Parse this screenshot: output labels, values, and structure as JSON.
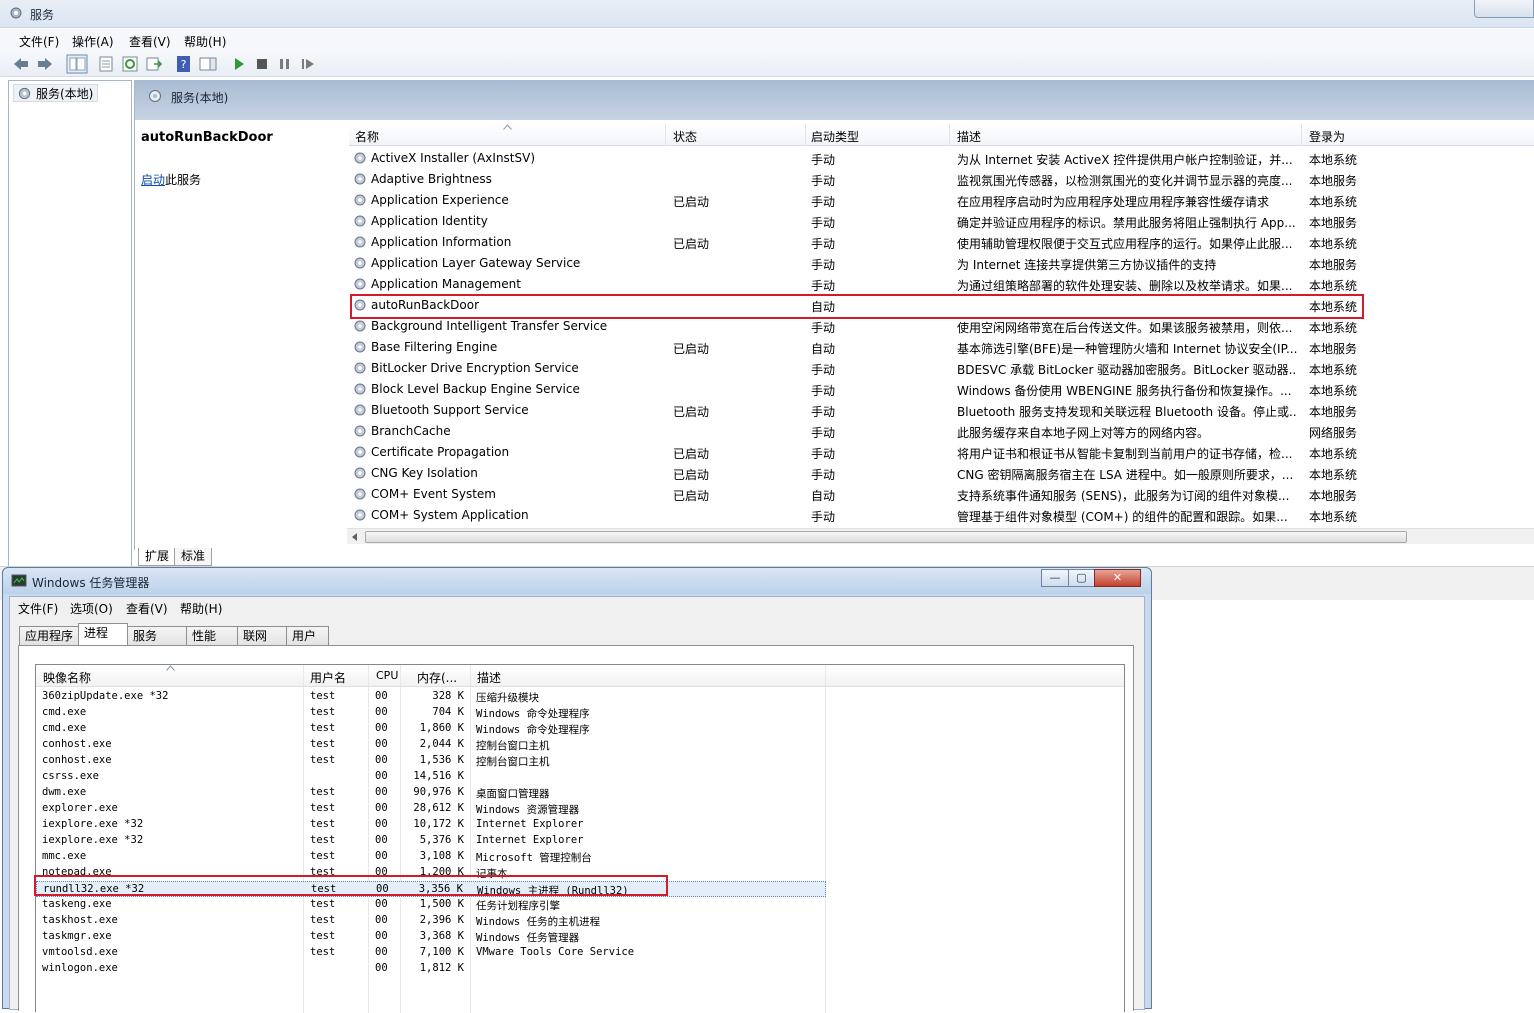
{
  "services": {
    "title": "服务",
    "menu": [
      "文件(F)",
      "操作(A)",
      "查看(V)",
      "帮助(H)"
    ],
    "tree_node": "服务(本地)",
    "header": "服务(本地)",
    "selected_name": "autoRunBackDoor",
    "start_link": "启动",
    "start_link_suffix": "此服务",
    "columns": {
      "name": "名称",
      "status": "状态",
      "startup": "启动类型",
      "desc": "描述",
      "logon": "登录为"
    },
    "rows": [
      {
        "name": "ActiveX Installer (AxInstSV)",
        "status": "",
        "startup": "手动",
        "desc": "为从 Internet 安装 ActiveX 控件提供用户帐户控制验证，并...",
        "logon": "本地系统"
      },
      {
        "name": "Adaptive Brightness",
        "status": "",
        "startup": "手动",
        "desc": "监视氛围光传感器，以检测氛围光的变化并调节显示器的亮度...",
        "logon": "本地服务"
      },
      {
        "name": "Application Experience",
        "status": "已启动",
        "startup": "手动",
        "desc": "在应用程序启动时为应用程序处理应用程序兼容性缓存请求",
        "logon": "本地系统"
      },
      {
        "name": "Application Identity",
        "status": "",
        "startup": "手动",
        "desc": "确定并验证应用程序的标识。禁用此服务将阻止强制执行 App...",
        "logon": "本地服务"
      },
      {
        "name": "Application Information",
        "status": "已启动",
        "startup": "手动",
        "desc": "使用辅助管理权限便于交互式应用程序的运行。如果停止此服...",
        "logon": "本地系统"
      },
      {
        "name": "Application Layer Gateway Service",
        "status": "",
        "startup": "手动",
        "desc": "为 Internet 连接共享提供第三方协议插件的支持",
        "logon": "本地服务"
      },
      {
        "name": "Application Management",
        "status": "",
        "startup": "手动",
        "desc": "为通过组策略部署的软件处理安装、删除以及枚举请求。如果...",
        "logon": "本地系统"
      },
      {
        "name": "autoRunBackDoor",
        "status": "",
        "startup": "自动",
        "desc": "",
        "logon": "本地系统"
      },
      {
        "name": "Background Intelligent Transfer Service",
        "status": "",
        "startup": "手动",
        "desc": "使用空闲网络带宽在后台传送文件。如果该服务被禁用，则依...",
        "logon": "本地系统"
      },
      {
        "name": "Base Filtering Engine",
        "status": "已启动",
        "startup": "自动",
        "desc": "基本筛选引擎(BFE)是一种管理防火墙和 Internet 协议安全(IP...",
        "logon": "本地服务"
      },
      {
        "name": "BitLocker Drive Encryption Service",
        "status": "",
        "startup": "手动",
        "desc": "BDESVC 承载 BitLocker 驱动器加密服务。BitLocker 驱动器...",
        "logon": "本地系统"
      },
      {
        "name": "Block Level Backup Engine Service",
        "status": "",
        "startup": "手动",
        "desc": "Windows 备份使用 WBENGINE 服务执行备份和恢复操作。...",
        "logon": "本地系统"
      },
      {
        "name": "Bluetooth Support Service",
        "status": "已启动",
        "startup": "手动",
        "desc": "Bluetooth 服务支持发现和关联远程 Bluetooth 设备。停止或...",
        "logon": "本地服务"
      },
      {
        "name": "BranchCache",
        "status": "",
        "startup": "手动",
        "desc": "此服务缓存来自本地子网上对等方的网络内容。",
        "logon": "网络服务"
      },
      {
        "name": "Certificate Propagation",
        "status": "已启动",
        "startup": "手动",
        "desc": "将用户证书和根证书从智能卡复制到当前用户的证书存储，检...",
        "logon": "本地系统"
      },
      {
        "name": "CNG Key Isolation",
        "status": "已启动",
        "startup": "手动",
        "desc": "CNG 密钥隔离服务宿主在 LSA 进程中。如一般原则所要求，...",
        "logon": "本地系统"
      },
      {
        "name": "COM+ Event System",
        "status": "已启动",
        "startup": "自动",
        "desc": "支持系统事件通知服务 (SENS)，此服务为订阅的组件对象模...",
        "logon": "本地服务"
      },
      {
        "name": "COM+ System Application",
        "status": "",
        "startup": "手动",
        "desc": "管理基于组件对象模型 (COM+) 的组件的配置和跟踪。如果...",
        "logon": "本地系统"
      }
    ],
    "tabs": [
      "扩展",
      "标准"
    ]
  },
  "taskmgr": {
    "title": "Windows 任务管理器",
    "menu": [
      "文件(F)",
      "选项(O)",
      "查看(V)",
      "帮助(H)"
    ],
    "tabs": [
      "应用程序",
      "进程",
      "服务",
      "性能",
      "联网",
      "用户"
    ],
    "active_tab": "进程",
    "columns": {
      "image": "映像名称",
      "user": "用户名",
      "cpu": "CPU",
      "mem": "内存(...",
      "desc": "描述"
    },
    "rows": [
      {
        "image": "360zipUpdate.exe *32",
        "user": "test",
        "cpu": "00",
        "mem": "328 K",
        "desc": "压缩升级模块"
      },
      {
        "image": "cmd.exe",
        "user": "test",
        "cpu": "00",
        "mem": "704 K",
        "desc": "Windows 命令处理程序"
      },
      {
        "image": "cmd.exe",
        "user": "test",
        "cpu": "00",
        "mem": "1,860 K",
        "desc": "Windows 命令处理程序"
      },
      {
        "image": "conhost.exe",
        "user": "test",
        "cpu": "00",
        "mem": "2,044 K",
        "desc": "控制台窗口主机"
      },
      {
        "image": "conhost.exe",
        "user": "test",
        "cpu": "00",
        "mem": "1,536 K",
        "desc": "控制台窗口主机"
      },
      {
        "image": "csrss.exe",
        "user": "",
        "cpu": "00",
        "mem": "14,516 K",
        "desc": ""
      },
      {
        "image": "dwm.exe",
        "user": "test",
        "cpu": "00",
        "mem": "90,976 K",
        "desc": "桌面窗口管理器"
      },
      {
        "image": "explorer.exe",
        "user": "test",
        "cpu": "00",
        "mem": "28,612 K",
        "desc": "Windows 资源管理器"
      },
      {
        "image": "iexplore.exe *32",
        "user": "test",
        "cpu": "00",
        "mem": "10,172 K",
        "desc": "Internet Explorer"
      },
      {
        "image": "iexplore.exe *32",
        "user": "test",
        "cpu": "00",
        "mem": "5,376 K",
        "desc": "Internet Explorer"
      },
      {
        "image": "mmc.exe",
        "user": "test",
        "cpu": "00",
        "mem": "3,108 K",
        "desc": "Microsoft 管理控制台"
      },
      {
        "image": "notepad.exe",
        "user": "test",
        "cpu": "00",
        "mem": "1,200 K",
        "desc": "记事本"
      },
      {
        "image": "rundll32.exe *32",
        "user": "test",
        "cpu": "00",
        "mem": "3,356 K",
        "desc": "Windows 主进程 (Rundll32)"
      },
      {
        "image": "taskeng.exe",
        "user": "test",
        "cpu": "00",
        "mem": "1,500 K",
        "desc": "任务计划程序引擎"
      },
      {
        "image": "taskhost.exe",
        "user": "test",
        "cpu": "00",
        "mem": "2,396 K",
        "desc": "Windows 任务的主机进程"
      },
      {
        "image": "taskmgr.exe",
        "user": "test",
        "cpu": "00",
        "mem": "3,368 K",
        "desc": "Windows 任务管理器"
      },
      {
        "image": "vmtoolsd.exe",
        "user": "test",
        "cpu": "00",
        "mem": "7,100 K",
        "desc": "VMware Tools Core Service"
      },
      {
        "image": "winlogon.exe",
        "user": "",
        "cpu": "00",
        "mem": "1,812 K",
        "desc": ""
      }
    ]
  },
  "colors": {
    "highlight_border": "#d21c2b",
    "link": "#0b4cb0",
    "header_bg": "#a9bcd3"
  }
}
